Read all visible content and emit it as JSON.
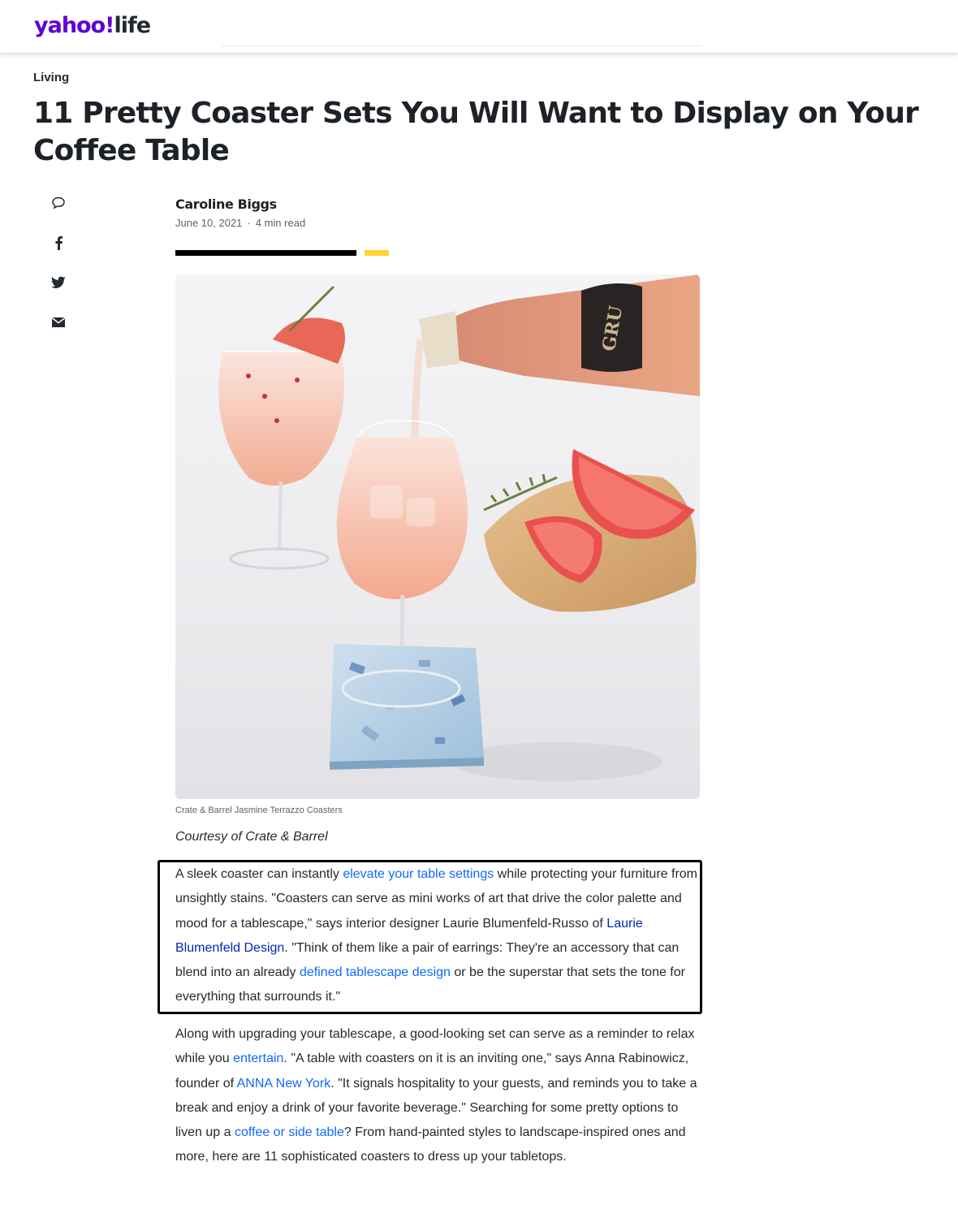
{
  "header": {
    "logo_brand": "yahoo!",
    "logo_section": "life"
  },
  "article": {
    "category": "Living",
    "headline": "11 Pretty Coaster Sets You Will Want to Display on Your Coffee Table",
    "author": "Caroline Biggs",
    "date": "June 10, 2021",
    "separator": "·",
    "read_time": "4 min read"
  },
  "share": {
    "icons": [
      "comment-icon",
      "facebook-icon",
      "twitter-icon",
      "email-icon"
    ]
  },
  "image": {
    "caption": "Crate & Barrel Jasmine Terrazzo Coasters",
    "credit": "Courtesy of Crate & Barrel",
    "bottle_label": "GRU"
  },
  "paragraph1": {
    "t1": "A sleek coaster can instantly ",
    "link1": "elevate your table settings",
    "t2": " while protecting your furniture from unsightly stains. \"Coasters can serve as mini works of art that drive the color palette and mood for a tablescape,\" says interior designer Laurie Blumenfeld-Russo of ",
    "link2": "Laurie Blumenfeld Design",
    "t3": ". \"Think of them like a pair of earrings: They're an accessory that can blend into an already ",
    "link3": "defined tablescape design",
    "t4": " or be the superstar that sets the tone for everything that surrounds it.\""
  },
  "paragraph2": {
    "t1": "Along with upgrading your tablescape, a good-looking set can serve as a reminder to relax while you ",
    "link1": "entertain",
    "t2": ". \"A table with coasters on it is an inviting one,\" says Anna Rabinowicz, founder of ",
    "link2": "ANNA New York",
    "t3": ". \"It signals hospitality to your guests, and reminds you to take a break and enjoy a drink of your favorite beverage.\" Searching for some pretty options to liven up a ",
    "link3": "coffee or side table",
    "t4": "? From hand-painted styles to landscape-inspired ones and more, here are 11 sophisticated coasters to dress up your tabletops."
  },
  "colors": {
    "brand": "#6001d2",
    "link": "#0f69ff",
    "link_visited": "#0026b8",
    "accent_yellow": "#ffd333"
  }
}
